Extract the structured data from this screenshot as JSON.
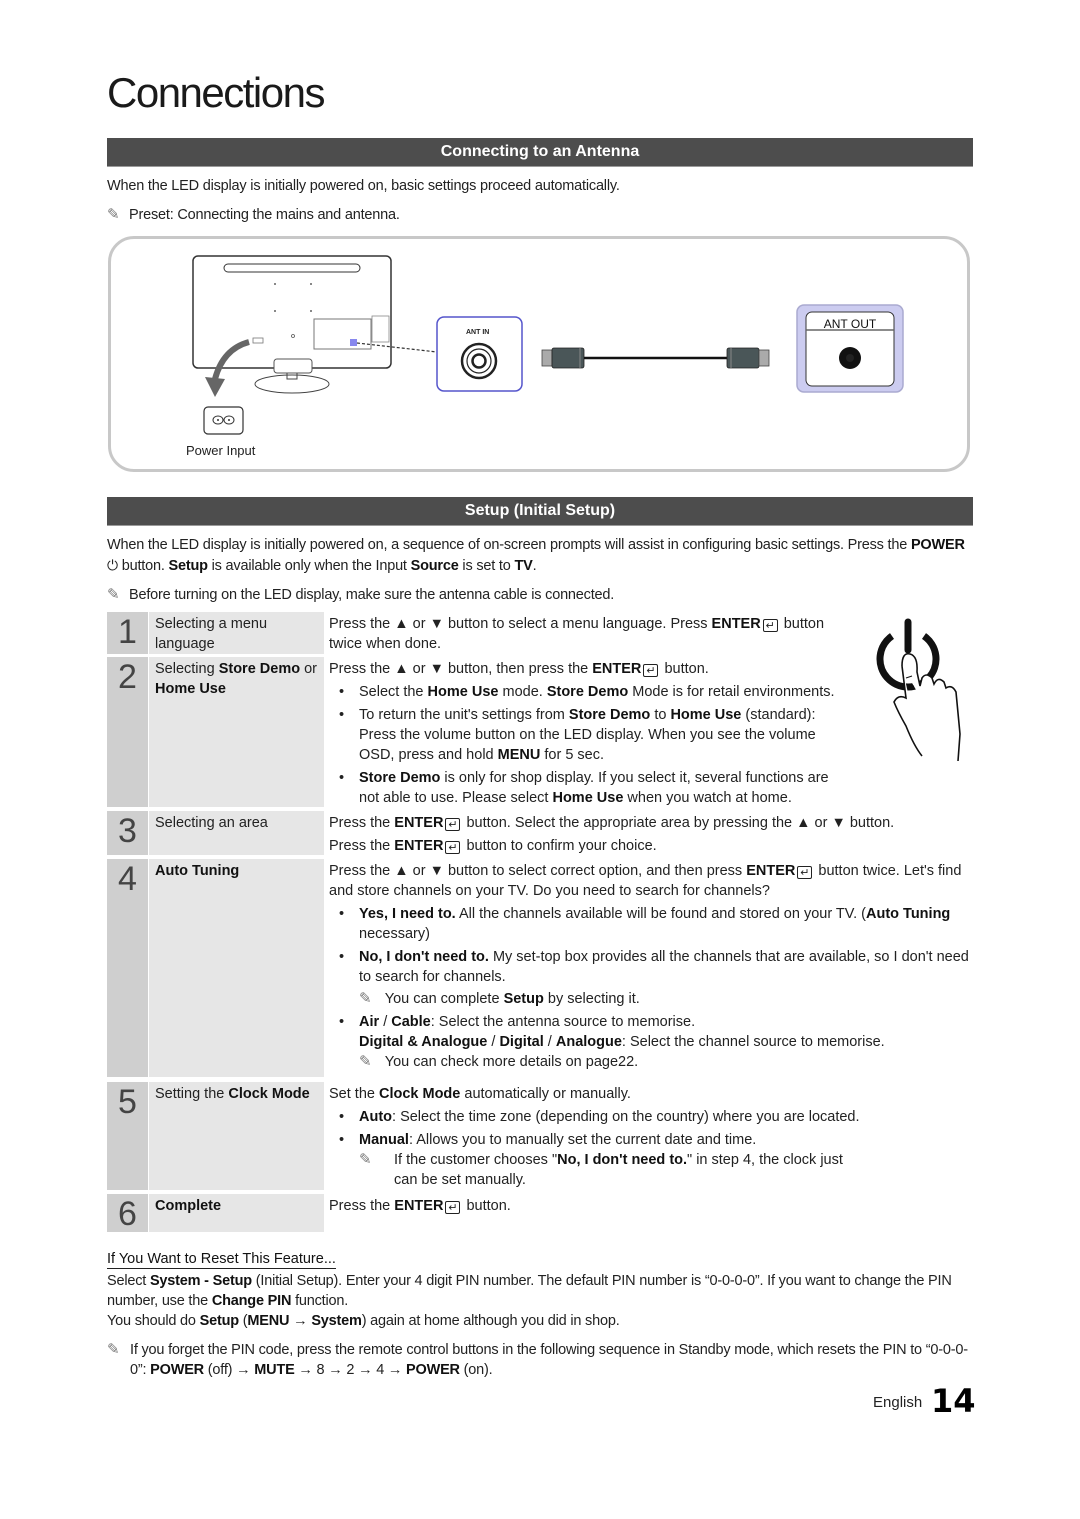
{
  "page": {
    "title": "Connections",
    "language": "English",
    "page_number": "14"
  },
  "antenna": {
    "section_title": "Connecting to an Antenna",
    "intro": "When the LED display is initially powered on, basic settings proceed automatically.",
    "note": "Preset: Connecting the mains and antenna.",
    "diagram": {
      "ant_in_label": "ANT IN",
      "ant_out_label": "ANT OUT",
      "power_input_label": "Power Input"
    }
  },
  "setup": {
    "section_title": "Setup (Initial Setup)",
    "intro_1": "When the LED display is initially powered on, a sequence of on-screen prompts will assist in configuring basic settings. Press the",
    "intro_power": "POWER",
    "intro_2": "button.",
    "intro_setup": "Setup",
    "intro_3": "is available only when the Input",
    "intro_source": "Source",
    "intro_4": "is set to",
    "intro_tv": "TV",
    "intro_5": ".",
    "note": "Before turning on the LED display, make sure the antenna cable is connected.",
    "steps": [
      {
        "number": "1",
        "label": "Selecting a menu language",
        "desc_a": "Press the ▲ or ▼ button to select a menu language. Press",
        "desc_enter": "ENTER",
        "desc_b": "button twice when done."
      },
      {
        "number": "2",
        "label_a": "Selecting",
        "label_b": "Store Demo",
        "label_c": "or",
        "label_d": "Home Use",
        "desc_a": "Press the ▲ or ▼ button, then press the",
        "desc_enter": "ENTER",
        "desc_b": "button.",
        "bullets": [
          {
            "a": "Select the",
            "b": "Home Use",
            "c": "mode.",
            "d": "Store Demo",
            "e": "Mode is for retail environments."
          },
          {
            "a": "To return the unit's settings from",
            "b": "Store Demo",
            "c": "to",
            "d": "Home Use",
            "e": "(standard): Press the volume button on the LED display. When you see the volume OSD, press and hold",
            "f": "MENU",
            "g": "for 5 sec."
          },
          {
            "a": "Store Demo",
            "b": "is only for shop display. If you select it, several functions are not able to use. Please select",
            "c": "Home Use",
            "d": "when you watch at home."
          }
        ]
      },
      {
        "number": "3",
        "label": "Selecting an area",
        "line1_a": "Press the",
        "line1_enter": "ENTER",
        "line1_b": "button. Select the appropriate area by pressing the ▲ or ▼ button.",
        "line2_a": "Press the",
        "line2_enter": "ENTER",
        "line2_b": "button to confirm your choice."
      },
      {
        "number": "4",
        "label": "Auto Tuning",
        "desc_a": "Press the ▲ or ▼ button to select correct option, and then press",
        "desc_enter": "ENTER",
        "desc_b": "button twice. Let's find and store channels on your TV. Do you need to search for channels?",
        "bullets": [
          {
            "a": "Yes, I need to.",
            "b": "All the channels available will be found and stored on your TV. (",
            "c": "Auto Tuning",
            "d": "necessary)"
          },
          {
            "a": "No, I don't need to.",
            "b": "My set-top box provides all the channels that are available, so I don't need to search for channels.",
            "note_a": "You can complete",
            "note_b": "Setup",
            "note_c": "by selecting it."
          },
          {
            "a": "Air",
            "b": "/",
            "c": "Cable",
            "d": ": Select the antenna source to memorise.",
            "e": "Digital & Analogue",
            "f": "/",
            "g": "Digital",
            "h": "/",
            "i": "Analogue",
            "j": ": Select the channel source to memorise.",
            "note": "You can check more details on page22."
          }
        ]
      },
      {
        "number": "5",
        "label_a": "Setting the",
        "label_b": "Clock Mode",
        "desc_a": "Set the",
        "desc_b": "Clock Mode",
        "desc_c": "automatically or manually.",
        "bullets": [
          {
            "a": "Auto",
            "b": ": Select the time zone (depending on the country) where you are located."
          },
          {
            "a": "Manual",
            "b": ": Allows you to manually set the current date and time.",
            "note_a": "If the customer chooses \"",
            "note_b": "No, I don't need to.",
            "note_c": "\" in step 4, the clock just can be set manually."
          }
        ]
      },
      {
        "number": "6",
        "label": "Complete",
        "desc_a": "Press the",
        "desc_enter": "ENTER",
        "desc_b": "button."
      }
    ]
  },
  "reset": {
    "title": "If You Want to Reset This Feature...",
    "p1_a": "Select",
    "p1_b": "System - Setup",
    "p1_c": "(Initial Setup). Enter your 4 digit PIN number. The default PIN number is “0-0-0-0”. If you want to change the PIN number, use the",
    "p1_d": "Change PIN",
    "p1_e": "function.",
    "p2_a": "You should do",
    "p2_b": "Setup",
    "p2_c": "(",
    "p2_d": "MENU",
    "p2_e": "→",
    "p2_f": "System",
    "p2_g": ") again at home although you did in shop.",
    "note_a": "If you forget the PIN code, press the remote control buttons in the following sequence in Standby mode, which resets the PIN to “0-0-0-0”:",
    "note_power1": "POWER",
    "note_b": "(off) →",
    "note_mute": "MUTE",
    "note_c": "→ 8 → 2 → 4 →",
    "note_power2": "POWER",
    "note_d": "(on)."
  }
}
